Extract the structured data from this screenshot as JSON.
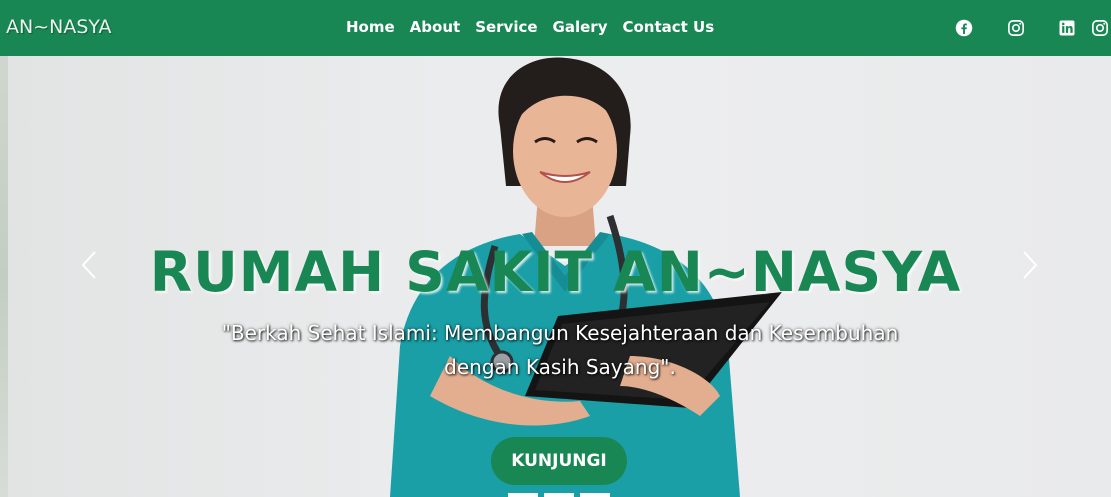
{
  "brand": {
    "name": "AN~NASYA"
  },
  "nav": {
    "links": [
      "Home",
      "About",
      "Service",
      "Galery",
      "Contact Us"
    ]
  },
  "socials": {
    "icons": [
      "facebook-icon",
      "instagram-icon",
      "linkedin-icon",
      "instagram-icon"
    ]
  },
  "hero": {
    "title": "RUMAH SAKIT AN~NASYA",
    "tagline": "\"Berkah Sehat Islami: Membangun Kesejahteraan dan Kesembuhan dengan Kasih Sayang\".",
    "cta_label": "KUNJUNGI",
    "slide_indicators": 3
  },
  "colors": {
    "primary": "#198754",
    "nav_text": "#ffffff",
    "hero_bg": "#e9eaeb"
  }
}
